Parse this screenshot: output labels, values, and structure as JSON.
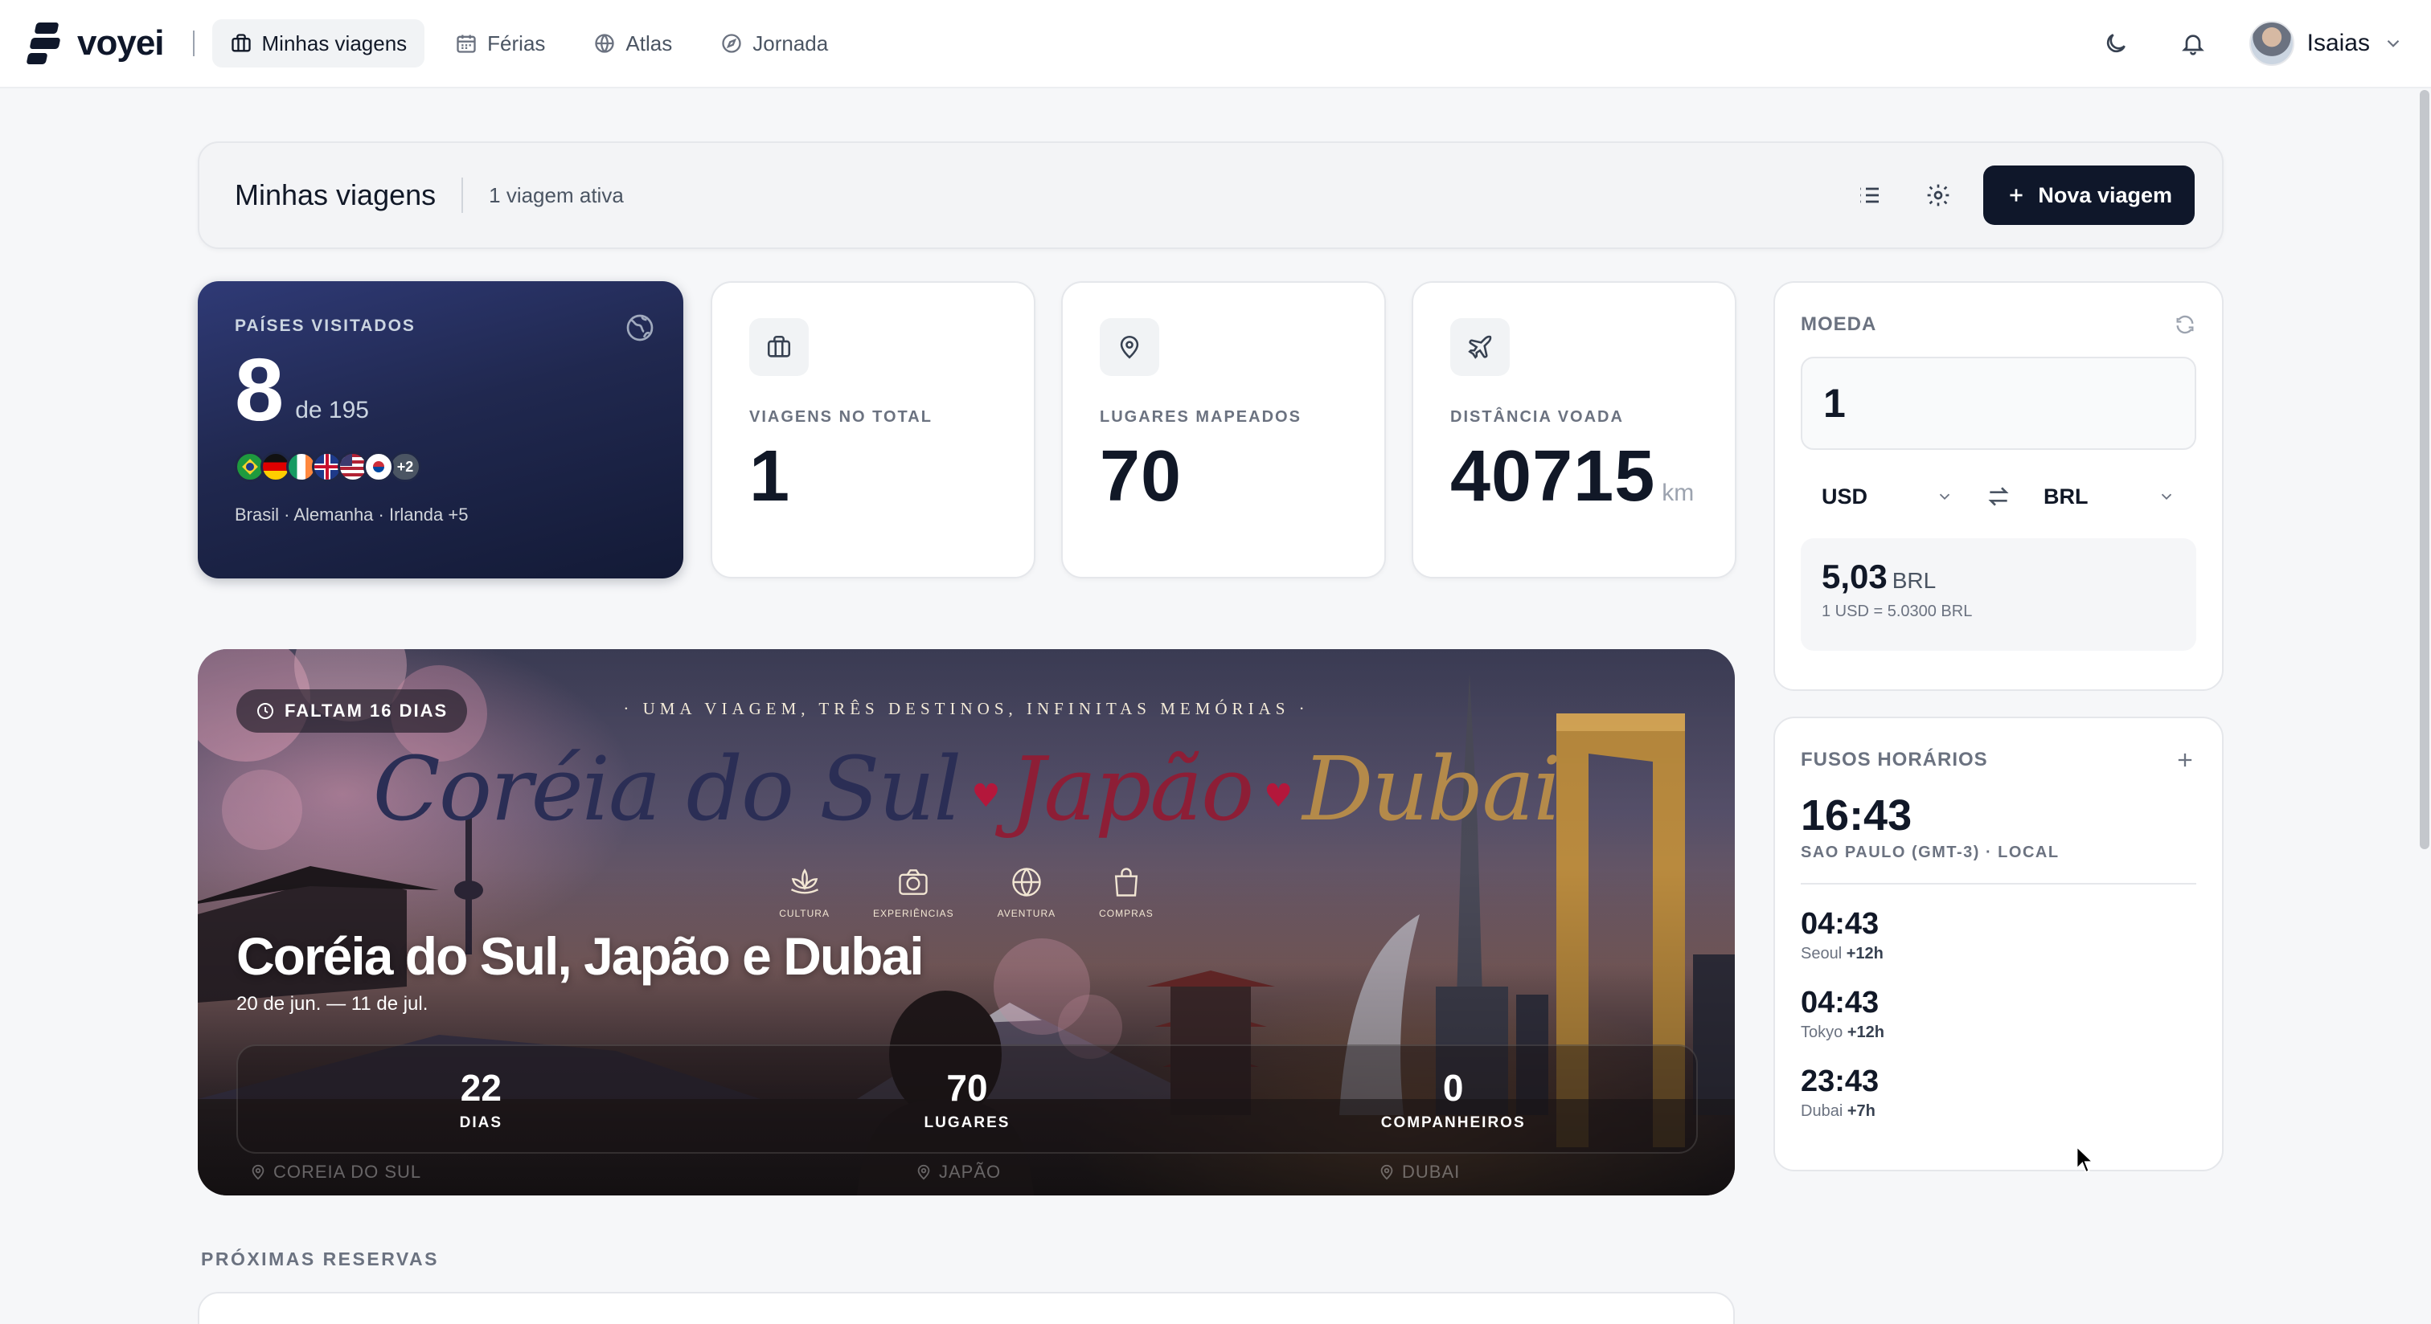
{
  "app": {
    "name": "voyei"
  },
  "nav": {
    "items": [
      {
        "label": "Minhas viagens",
        "icon": "briefcase-icon",
        "active": true
      },
      {
        "label": "Férias",
        "icon": "calendar-icon",
        "active": false
      },
      {
        "label": "Atlas",
        "icon": "globe-icon",
        "active": false
      },
      {
        "label": "Jornada",
        "icon": "compass-icon",
        "active": false
      }
    ],
    "user_name": "Isaias"
  },
  "header": {
    "title": "Minhas viagens",
    "subtitle": "1 viagem ativa",
    "new_trip_label": "Nova viagem"
  },
  "countries": {
    "label": "PAÍSES VISITADOS",
    "count": "8",
    "of_label": "de 195",
    "flags": [
      "brazil",
      "germany",
      "ireland",
      "united-kingdom",
      "united-states",
      "south-korea"
    ],
    "more": "+2",
    "names": "Brasil · Alemanha · Irlanda +5"
  },
  "stats": [
    {
      "label": "VIAGENS NO TOTAL",
      "value": "1",
      "unit": "",
      "icon": "briefcase-icon"
    },
    {
      "label": "LUGARES MAPEADOS",
      "value": "70",
      "unit": "",
      "icon": "map-pin-icon"
    },
    {
      "label": "DISTÂNCIA VOADA",
      "value": "40715",
      "unit": "km",
      "icon": "plane-icon"
    }
  ],
  "currency": {
    "title": "MOEDA",
    "amount": "1",
    "from": "USD",
    "to": "BRL",
    "result": "5,03",
    "result_unit": "BRL",
    "rate_text": "1 USD = 5.0300 BRL"
  },
  "timezones": {
    "title": "FUSOS HORÁRIOS",
    "local": {
      "time": "16:43",
      "label": "SAO PAULO (GMT-3) · LOCAL"
    },
    "items": [
      {
        "time": "04:43",
        "city": "Seoul",
        "offset": "+12h"
      },
      {
        "time": "04:43",
        "city": "Tokyo",
        "offset": "+12h"
      },
      {
        "time": "23:43",
        "city": "Dubai",
        "offset": "+7h"
      }
    ]
  },
  "trip": {
    "countdown": "FALTAM 16 DIAS",
    "poster": {
      "tagline": "· UMA VIAGEM, TRÊS DESTINOS, INFINITAS MEMÓRIAS ·",
      "title_parts": [
        "Coréia do Sul",
        "Japão",
        "Dubai"
      ],
      "icons": [
        {
          "label": "CULTURA",
          "icon": "lotus-icon"
        },
        {
          "label": "EXPERIÊNCIAS",
          "icon": "camera-icon"
        },
        {
          "label": "AVENTURA",
          "icon": "globe-icon"
        },
        {
          "label": "COMPRAS",
          "icon": "shopping-bag-icon"
        }
      ]
    },
    "title": "Coréia do Sul, Japão e Dubai",
    "dates": "20 de jun. — 11 de jul.",
    "stats": [
      {
        "value": "22",
        "label": "DIAS"
      },
      {
        "value": "70",
        "label": "LUGARES"
      },
      {
        "value": "0",
        "label": "COMPANHEIROS"
      }
    ],
    "destinations": [
      "COREIA DO SUL",
      "JAPÃO",
      "DUBAI"
    ]
  },
  "reservations": {
    "title": "PRÓXIMAS RESERVAS"
  },
  "colors": {
    "primary": "#0f172a",
    "accent_card": "#2f3a76",
    "background": "#f6f7f9"
  }
}
